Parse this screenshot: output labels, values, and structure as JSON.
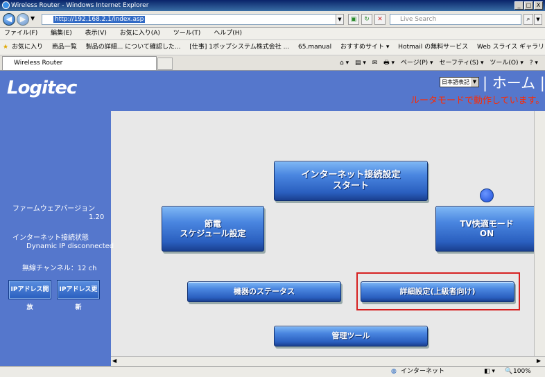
{
  "window": {
    "title": "Wireless Router - Windows Internet Explorer",
    "minimize": "_",
    "maximize": "□",
    "close": "X"
  },
  "address": {
    "url": "http://192.168.2.1/index.asp",
    "search_placeholder": "Live Search"
  },
  "menu": [
    "ファイル(F)",
    "編集(E)",
    "表示(V)",
    "お気に入り(A)",
    "ツール(T)",
    "ヘルプ(H)"
  ],
  "favorites": [
    "お気に入り",
    "商品一覧",
    "製品の詳細... について確認した...",
    "[仕事] 1ポップシステム株式会社 ...",
    "65.manual",
    "おすすめサイト ▾",
    "Hotmail の無料サービス",
    "Web スライス ギャラリー ▾"
  ],
  "tab": {
    "title": "Wireless Router"
  },
  "cmdbar": [
    "⌂ ▾",
    "▤ ▾",
    "✉",
    "🖶 ▾",
    "ページ(P) ▾",
    "セーフティ(S) ▾",
    "ツール(O) ▾",
    "? ▾"
  ],
  "router": {
    "logo": "Logitec",
    "language": "日本語表記",
    "home_title": "| ホーム |",
    "mode_status": "ルータモードで動作しています。",
    "firmware_label": "ファームウェアバージョン",
    "firmware_version": "1.20",
    "connection_label": "インターネット接続状態",
    "connection_value": "Dynamic IP disconnected",
    "channel": "無線チャンネル：12 ch",
    "ip_release": "IPアドレス開放",
    "ip_renew": "IPアドレス更新",
    "btn_internet_1": "インターネット接続設定",
    "btn_internet_2": "スタート",
    "btn_energy_1": "節電",
    "btn_energy_2": "スケジュール設定",
    "btn_tv_1": "TV快適モード",
    "btn_tv_2": "ON",
    "btn_status": "機器のステータス",
    "btn_advanced": "詳細設定(上級者向け)",
    "btn_admin": "管理ツール"
  },
  "status": {
    "zone": "インターネット",
    "zoom": "100%"
  }
}
